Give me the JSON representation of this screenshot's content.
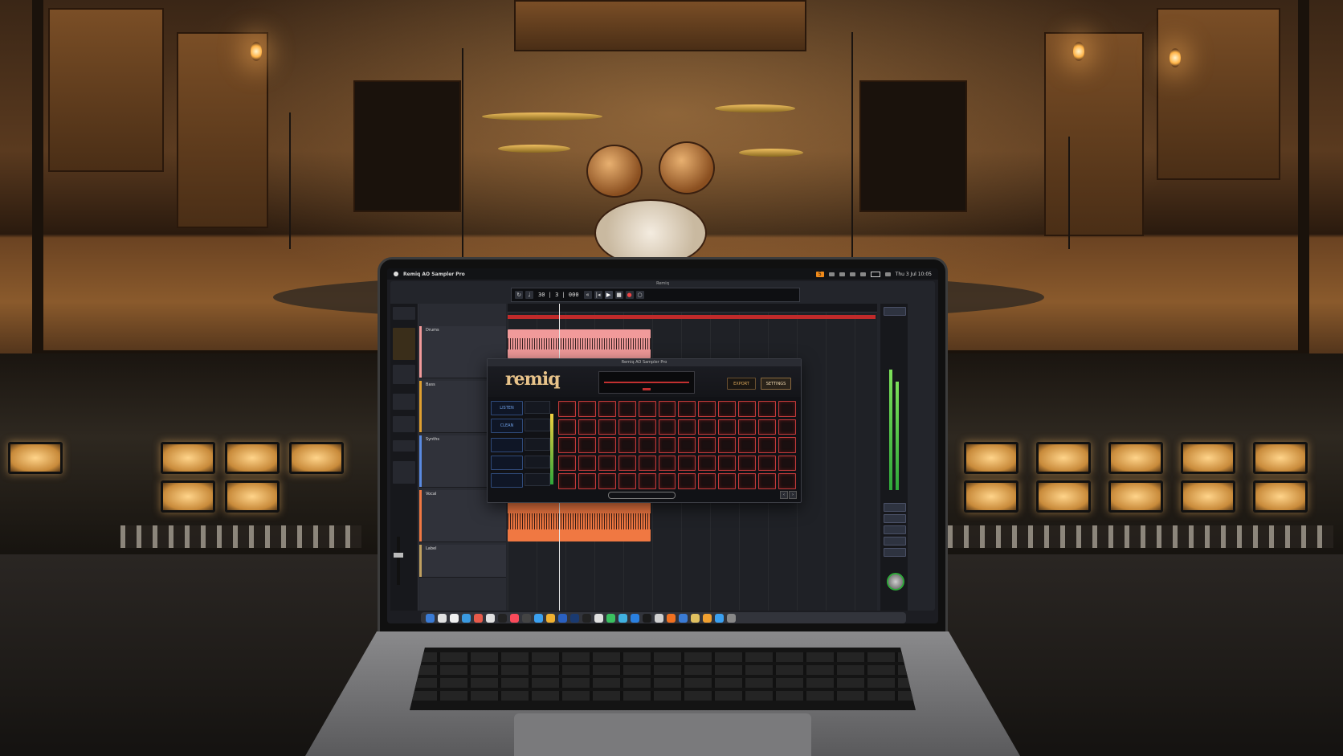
{
  "menubar": {
    "app_title": "Remiq AO Sampler Pro",
    "record_badge": "5",
    "status_right": "Thu 3 Jul 10:05"
  },
  "daw": {
    "window_title": "Remiq",
    "transport_counter": "30 | 3 | 000",
    "tracks": [
      {
        "name": "Drums",
        "color": "#f19a9a"
      },
      {
        "name": "Bass",
        "color": "#e0a030"
      },
      {
        "name": "Synths",
        "color": "#5a8ae0"
      },
      {
        "name": "Vocal",
        "color": "#f07842"
      },
      {
        "name": "Label",
        "color": "#c0a060"
      }
    ]
  },
  "plugin": {
    "window_title": "Remiq AO Sampler Pro",
    "logo": "remiq",
    "export_label": "EXPORT",
    "settings_label": "SETTINGS",
    "modes": [
      "LISTEN",
      "CLEAN"
    ],
    "pad_rows": 5,
    "pad_cols": 12,
    "colors": {
      "accent": "#e8c38a",
      "pad_border": "#c23a3a",
      "mode": "#6fa0e8"
    }
  },
  "dock": {
    "icon_colors": [
      "#3a7bd5",
      "#e0e0e0",
      "#f0f0f0",
      "#3a9ae0",
      "#e85a4a",
      "#e0e0e0",
      "#222",
      "#fa4a5a",
      "#444",
      "#3aa0f0",
      "#f0b030",
      "#2a60c0",
      "#1a3a70",
      "#222",
      "#e0e0e0",
      "#3ac060",
      "#40b0e0",
      "#2a80e0",
      "#1a1a1a",
      "#d0d0d0",
      "#f07020",
      "#3a7bd5",
      "#e0c060",
      "#f0a030",
      "#3aa0f0",
      "#888"
    ]
  }
}
